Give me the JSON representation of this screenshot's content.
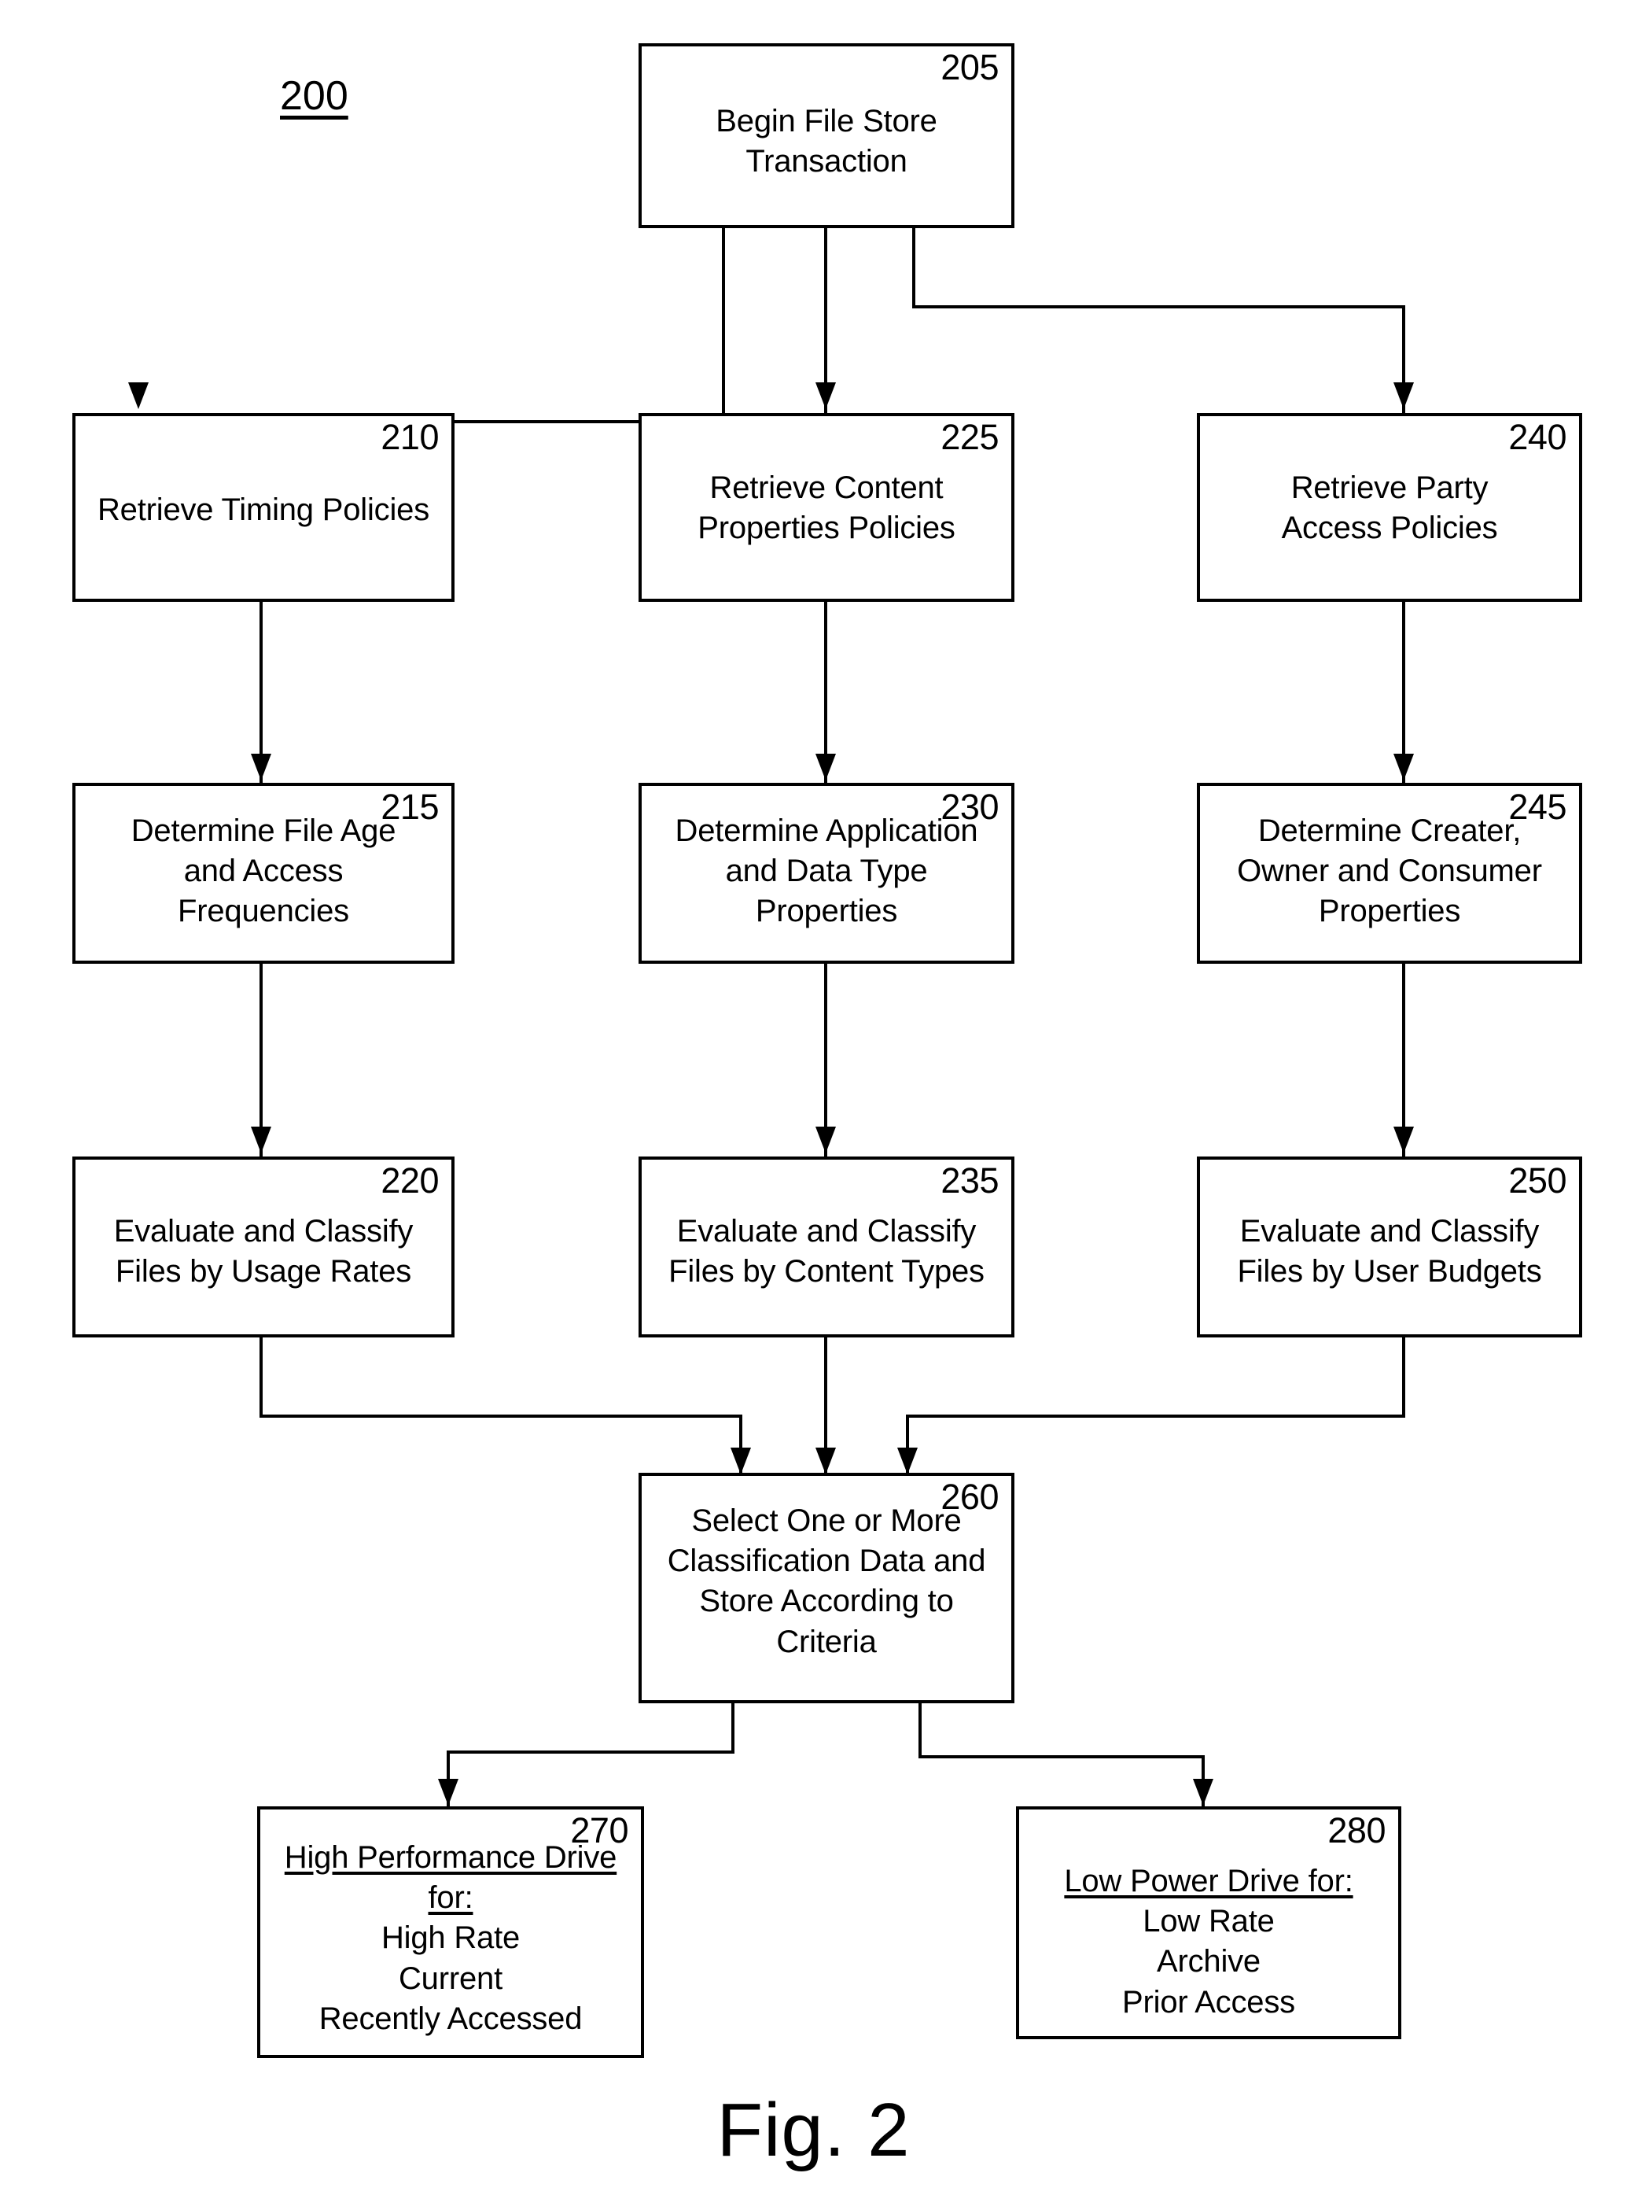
{
  "figure": {
    "ref_number": "200",
    "caption": "Fig. 2"
  },
  "nodes": {
    "n205": {
      "ref": "205",
      "text": "Begin File Store\nTransaction"
    },
    "n210": {
      "ref": "210",
      "text": "Retrieve Timing Policies"
    },
    "n225": {
      "ref": "225",
      "text": "Retrieve Content\nProperties Policies"
    },
    "n240": {
      "ref": "240",
      "text": "Retrieve Party\nAccess Policies"
    },
    "n215": {
      "ref": "215",
      "text": "Determine File Age\nand Access\nFrequencies"
    },
    "n230": {
      "ref": "230",
      "text": "Determine Application\nand Data Type\nProperties"
    },
    "n245": {
      "ref": "245",
      "text": "Determine Creater,\nOwner and Consumer\nProperties"
    },
    "n220": {
      "ref": "220",
      "text": "Evaluate and Classify\nFiles by Usage Rates"
    },
    "n235": {
      "ref": "235",
      "text": "Evaluate and Classify\nFiles by Content Types"
    },
    "n250": {
      "ref": "250",
      "text": "Evaluate and Classify\nFiles by User Budgets"
    },
    "n260": {
      "ref": "260",
      "text": "Select One or More\nClassification Data and\nStore According to\nCriteria"
    },
    "n270": {
      "ref": "270",
      "heading": "High Performance Drive for:",
      "lines": "High Rate\nCurrent\nRecently Accessed"
    },
    "n280": {
      "ref": "280",
      "heading": "Low Power Drive for:",
      "lines": "Low Rate\nArchive\nPrior Access"
    }
  },
  "colors": {
    "stroke": "#000000",
    "background": "#ffffff"
  }
}
